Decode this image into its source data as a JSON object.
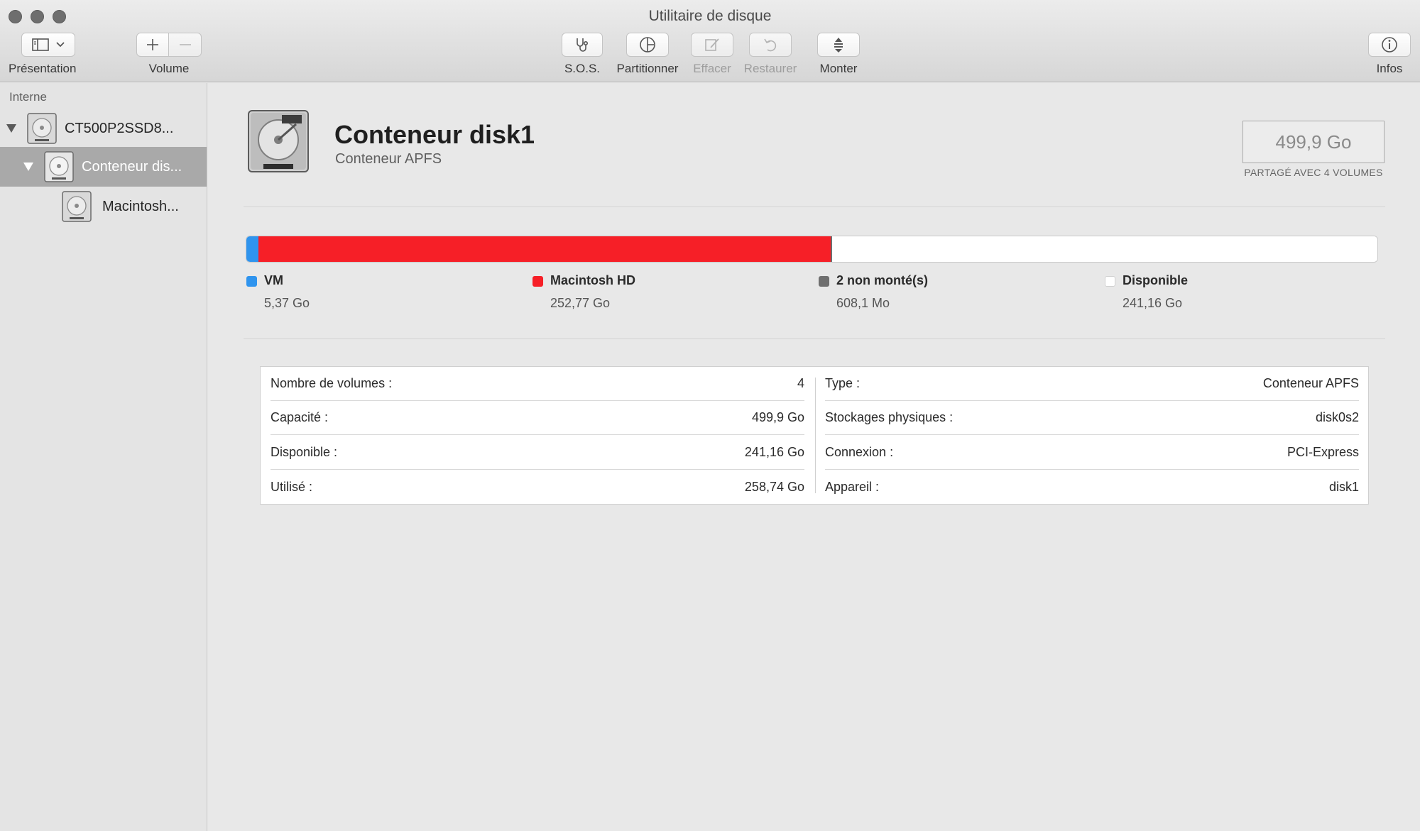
{
  "window": {
    "title": "Utilitaire de disque"
  },
  "toolbar": {
    "presentation_label": "Présentation",
    "volume_label": "Volume",
    "sos_label": "S.O.S.",
    "partition_label": "Partitionner",
    "erase_label": "Effacer",
    "restore_label": "Restaurer",
    "mount_label": "Monter",
    "info_label": "Infos"
  },
  "sidebar": {
    "section": "Interne",
    "items": [
      {
        "label": "CT500P2SSD8..."
      },
      {
        "label": "Conteneur dis..."
      },
      {
        "label": "Macintosh..."
      }
    ]
  },
  "detail": {
    "title": "Conteneur disk1",
    "subtitle": "Conteneur APFS",
    "capacity": "499,9 Go",
    "shared_note": "PARTAGÉ AVEC 4 VOLUMES"
  },
  "usage": {
    "segments": [
      {
        "name": "VM",
        "value": "5,37 Go",
        "gb": 5.37,
        "color": "#2f94ee"
      },
      {
        "name": "Macintosh HD",
        "value": "252,77 Go",
        "gb": 252.77,
        "color": "#f61f27"
      },
      {
        "name": "2 non monté(s)",
        "value": "608,1 Mo",
        "gb": 0.6081,
        "color": "#6f6f6f"
      },
      {
        "name": "Disponible",
        "value": "241,16 Go",
        "gb": 241.16,
        "color": "#ffffff"
      }
    ]
  },
  "info": {
    "left": [
      {
        "label": "Nombre de volumes :",
        "value": "4"
      },
      {
        "label": "Capacité :",
        "value": "499,9 Go"
      },
      {
        "label": "Disponible :",
        "value": "241,16 Go"
      },
      {
        "label": "Utilisé :",
        "value": "258,74 Go"
      }
    ],
    "right": [
      {
        "label": "Type :",
        "value": "Conteneur APFS"
      },
      {
        "label": "Stockages physiques :",
        "value": "disk0s2"
      },
      {
        "label": "Connexion :",
        "value": "PCI-Express"
      },
      {
        "label": "Appareil :",
        "value": "disk1"
      }
    ]
  }
}
